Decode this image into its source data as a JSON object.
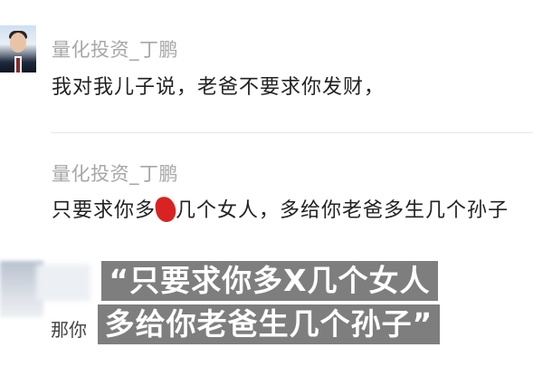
{
  "comments": [
    {
      "username": "量化投资_丁鹏",
      "text": "我对我儿子说，老爸不要求你发财，"
    },
    {
      "username": "量化投资_丁鹏",
      "text_before": "只要求你多",
      "text_after": "几个女人，多给你老爸多生几个孙子"
    }
  ],
  "partial_comment": "那你",
  "subtitle": {
    "line1": "“只要求你多X几个女人",
    "line2": "多给你老爸生几个孙子”"
  },
  "colors": {
    "username": "#a7a7a7",
    "text": "#222222",
    "redaction": "#d92323",
    "subtitle_bg": "#5a5a5a"
  }
}
